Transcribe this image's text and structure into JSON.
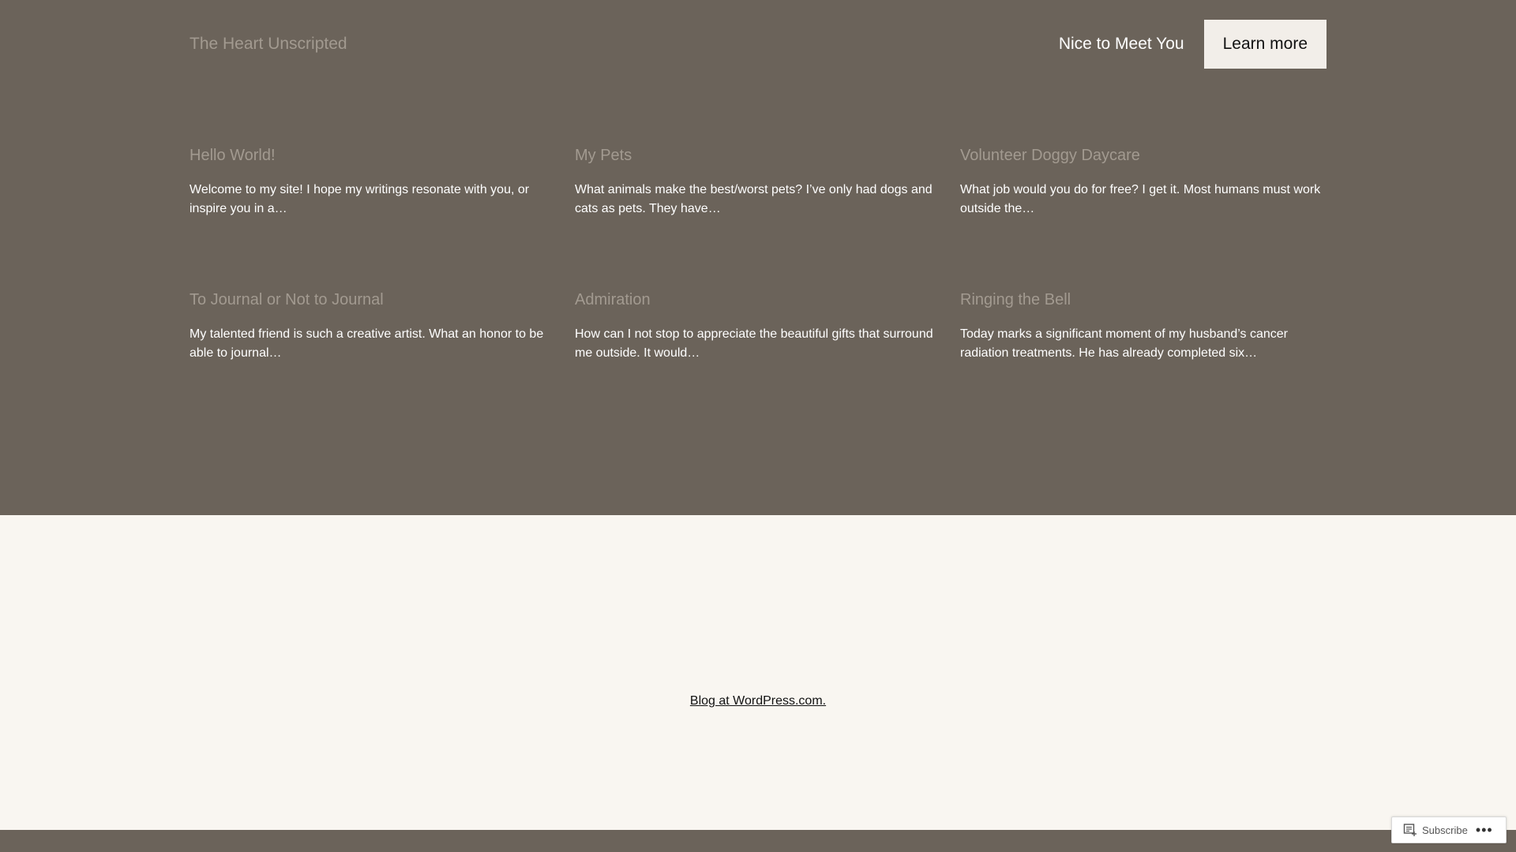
{
  "header": {
    "site_title": "The Heart Unscripted",
    "nav_link": "Nice to Meet You",
    "nav_button": "Learn more"
  },
  "posts": [
    {
      "title": "Hello World!",
      "excerpt": "Welcome to my site! I hope my writings resonate with you, or inspire you in a…"
    },
    {
      "title": "My Pets",
      "excerpt": "What animals make the best/worst pets? I’ve only had dogs and cats as pets. They have…"
    },
    {
      "title": "Volunteer Doggy Daycare",
      "excerpt": "What job would you do for free? I get it. Most humans must work outside the…"
    },
    {
      "title": "To Journal or Not to Journal",
      "excerpt": "My talented friend is such a creative artist. What an honor to be able to journal…"
    },
    {
      "title": "Admiration",
      "excerpt": "How can I not stop to appreciate the beautiful gifts that surround me outside. It would…"
    },
    {
      "title": "Ringing the Bell",
      "excerpt": "Today marks a significant moment of my husband’s cancer radiation treatments. He has already completed six…"
    }
  ],
  "footer": {
    "credit_link": "Blog at WordPress.com."
  },
  "subscribe_widget": {
    "label": "Subscribe",
    "more": "•••",
    "icon": "subscribe-reader-icon"
  },
  "colors": {
    "background": "#6b635a",
    "footer_background": "#f9f6f1",
    "muted_text": "#a29a90",
    "button_background": "#f2eee9"
  }
}
